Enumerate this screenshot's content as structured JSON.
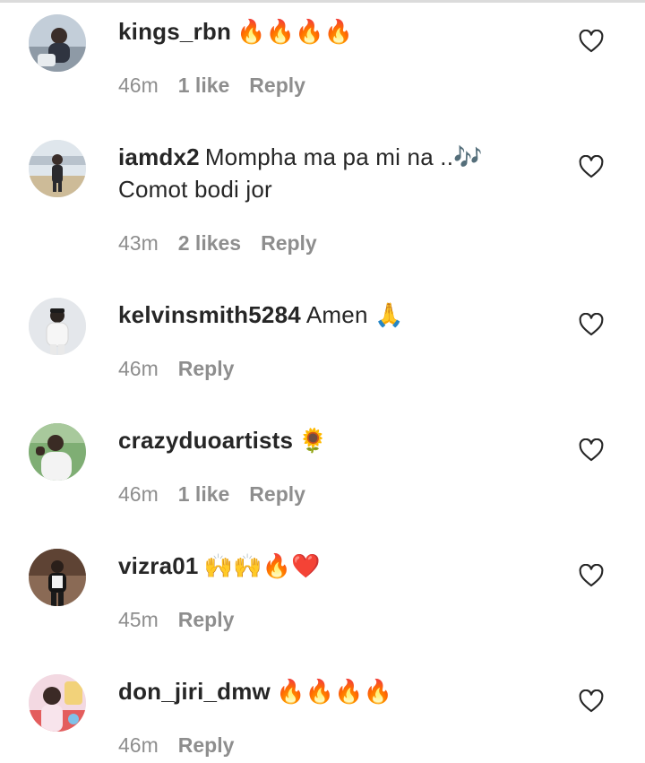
{
  "comments": [
    {
      "username": "kings_rbn",
      "text": "🔥🔥🔥🔥",
      "time": "46m",
      "likes": "1 like",
      "reply": "Reply",
      "avatar_colors": [
        "#9fb4c8",
        "#3a3d45",
        "#d7dde3"
      ]
    },
    {
      "username": "iamdx2",
      "text": "Mompha ma pa mi na ..🎶",
      "text_line2": "Comot bodi jor",
      "time": "43m",
      "likes": "2 likes",
      "reply": "Reply",
      "avatar_colors": [
        "#c9d4df",
        "#2e2e33",
        "#d9c7a8"
      ]
    },
    {
      "username": "kelvinsmith5284",
      "text": "Amen 🙏",
      "time": "46m",
      "likes": "",
      "reply": "Reply",
      "avatar_colors": [
        "#e3e6ea",
        "#f4f4f4",
        "#2b2b2b"
      ]
    },
    {
      "username": "crazyduoartists",
      "text": "🌻",
      "time": "46m",
      "likes": "1 like",
      "reply": "Reply",
      "avatar_colors": [
        "#6fa06a",
        "#f2f2f2",
        "#3a2b24"
      ]
    },
    {
      "username": "vizra01",
      "text": "🙌🙌🔥❤️",
      "time": "45m",
      "likes": "",
      "reply": "Reply",
      "avatar_colors": [
        "#6b4a3a",
        "#1c1c1c",
        "#efefef"
      ]
    },
    {
      "username": "don_jiri_dmw",
      "text": "🔥🔥🔥🔥",
      "time": "46m",
      "likes": "",
      "reply": "Reply",
      "avatar_colors": [
        "#e7b9c9",
        "#d94a4a",
        "#f1d57a"
      ]
    }
  ],
  "icons": {
    "like": "heart-outline-icon"
  },
  "colors": {
    "text": "#262626",
    "meta": "#8e8e8e",
    "background": "#ffffff"
  }
}
